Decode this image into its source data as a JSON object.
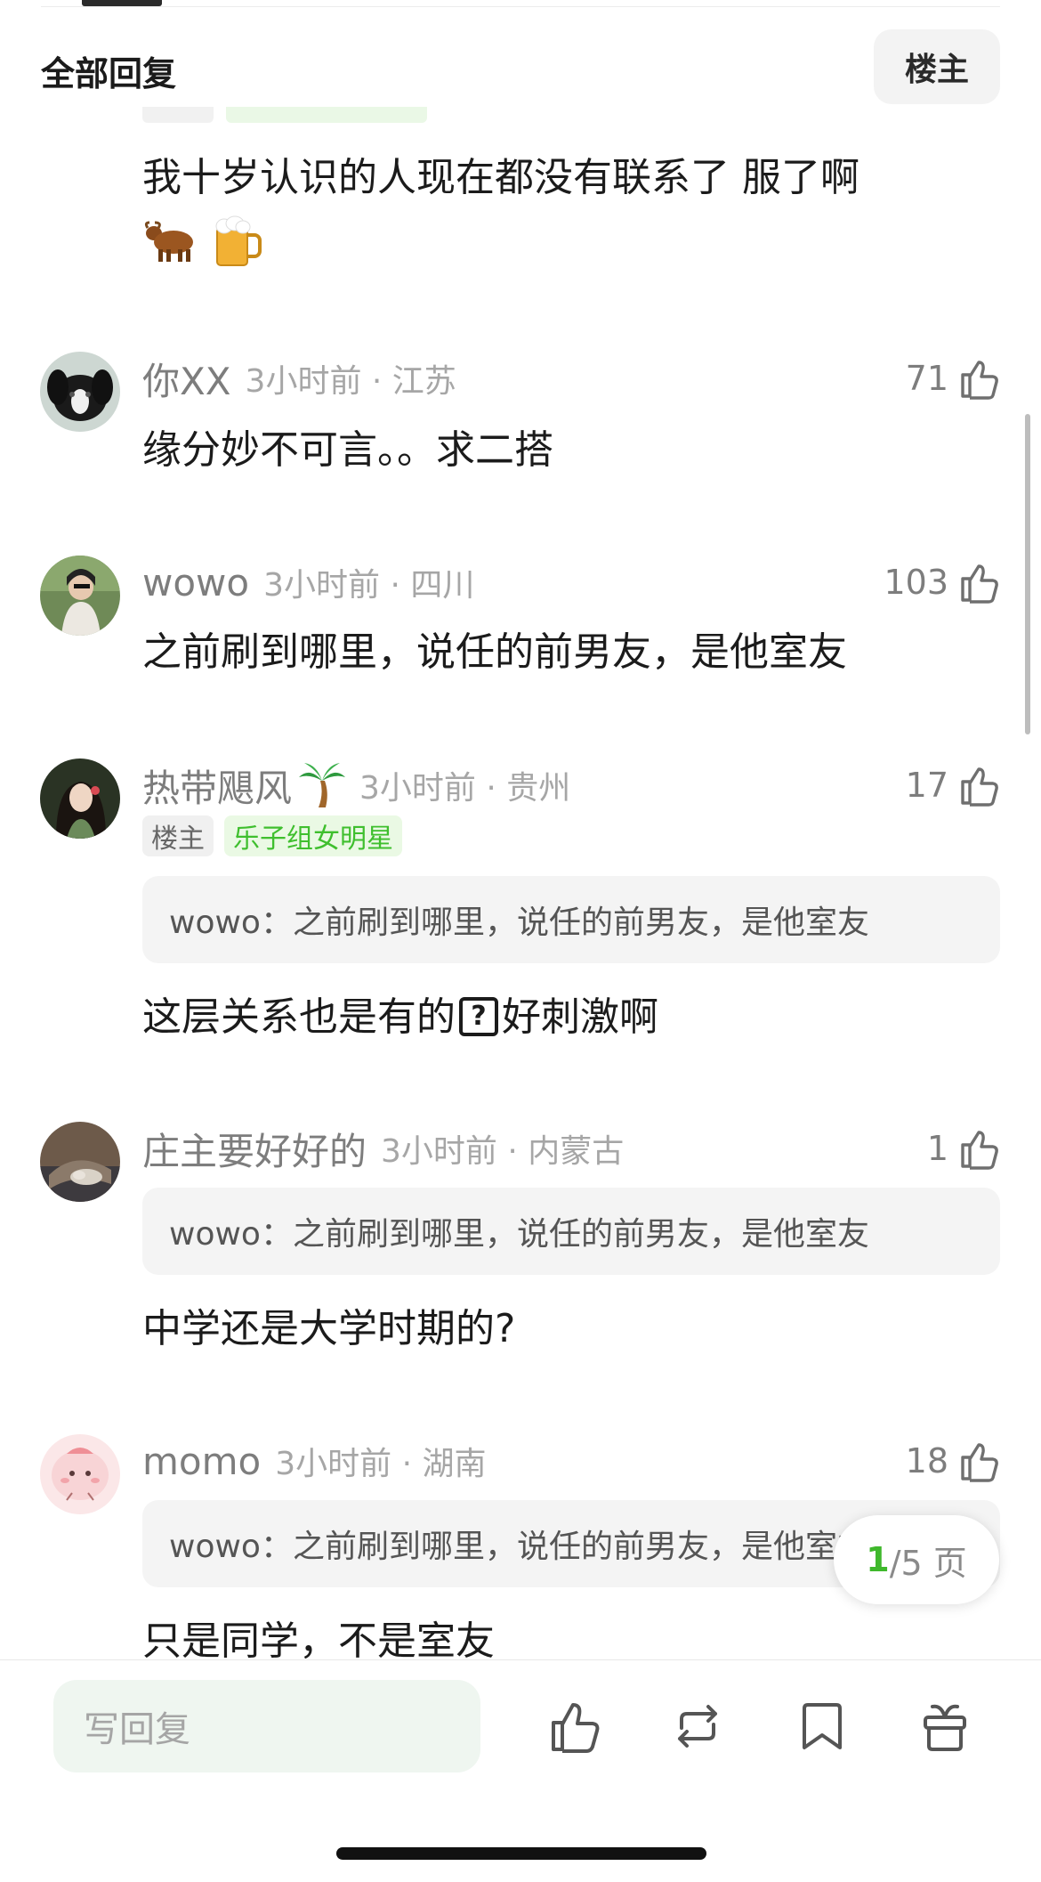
{
  "header": {
    "title": "全部回复",
    "op_filter": "楼主"
  },
  "partial_comment": {
    "text": "我十岁认识的人现在都没有联系了 服了啊",
    "emojis": [
      "🐂",
      "🍺"
    ]
  },
  "comments": [
    {
      "user": "你XX",
      "time_loc": "3小时前 · 江苏",
      "likes": "71",
      "text": "缘分妙不可言。。求二搭"
    },
    {
      "user": "wowo",
      "time_loc": "3小时前 · 四川",
      "likes": "103",
      "text": "之前刷到哪里，说任的前男友，是他室友"
    },
    {
      "user": "热带飓风",
      "user_emoji": "🌴",
      "time_loc": "3小时前 · 贵州",
      "likes": "17",
      "tags": [
        "楼主",
        "乐子组女明星"
      ],
      "quote": "wowo：之前刷到哪里，说任的前男友，是他室友",
      "text_before": "这层关系也是有的",
      "text_after": "好刺激啊",
      "emoji_box": "?"
    },
    {
      "user": "庄主要好好的",
      "time_loc": "3小时前 · 内蒙古",
      "likes": "1",
      "quote": "wowo：之前刷到哪里，说任的前男友，是他室友",
      "text": "中学还是大学时期的?"
    },
    {
      "user": "momo",
      "time_loc": "3小时前 · 湖南",
      "likes": "18",
      "quote": "wowo：之前刷到哪里，说任的前男友，是他室友",
      "text": "只是同学，不是室友"
    }
  ],
  "pagination": {
    "current": "1",
    "total_label": "/5 页"
  },
  "bottom_bar": {
    "reply_placeholder": "写回复"
  },
  "icons": [
    "thumb-up-icon",
    "repost-icon",
    "bookmark-icon",
    "gift-icon"
  ],
  "colors": {
    "accent_green": "#3fb82c",
    "tag_green_bg": "#eaf9e4",
    "input_bg": "#eff6f0"
  }
}
